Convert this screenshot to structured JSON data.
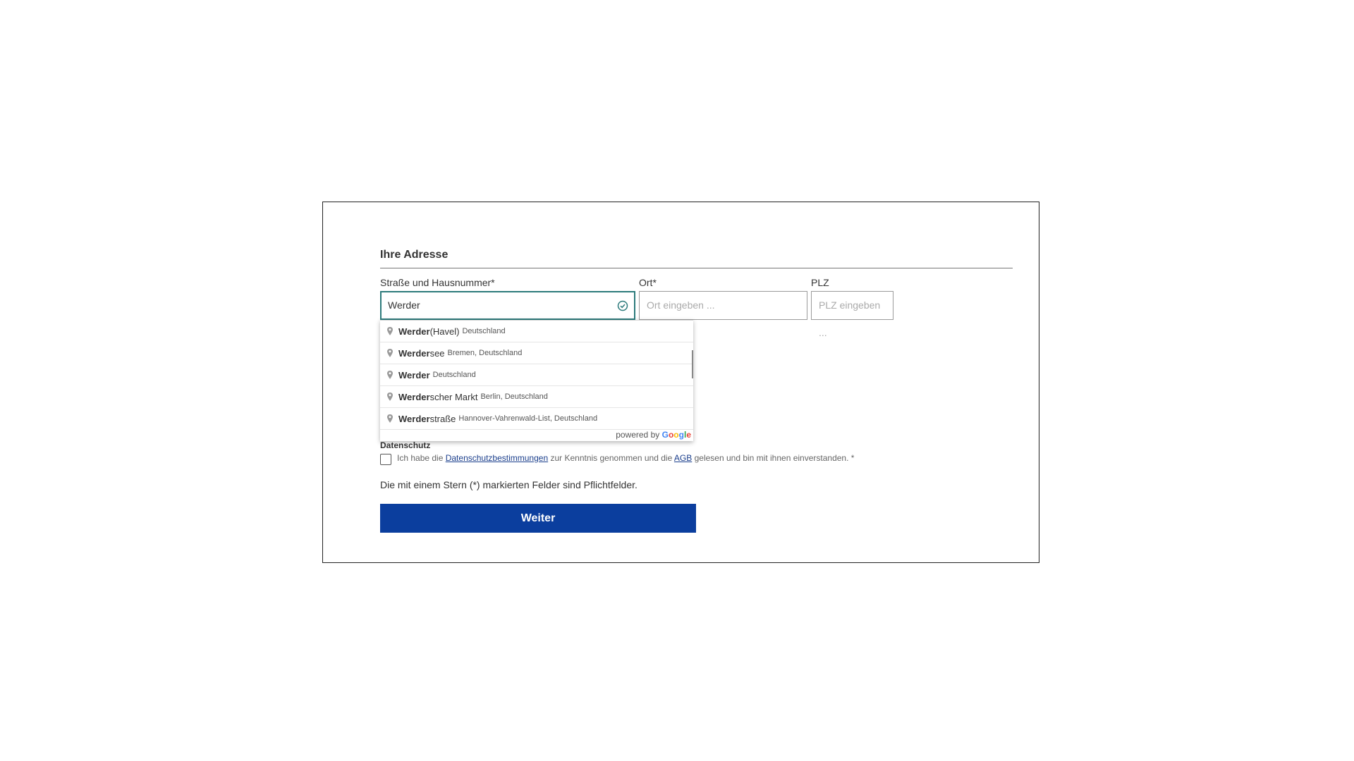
{
  "section_title": "Ihre Adresse",
  "fields": {
    "street": {
      "label": "Straße und Hausnummer*",
      "value": "Werder"
    },
    "city": {
      "label": "Ort*",
      "placeholder": "Ort eingeben ..."
    },
    "zip": {
      "label": "PLZ",
      "placeholder": "PLZ eingeben ..."
    }
  },
  "autocomplete": {
    "items": [
      {
        "match": "Werder",
        "rest": " (Havel)",
        "secondary": "Deutschland"
      },
      {
        "match": "Werder",
        "rest": "see",
        "secondary": "Bremen, Deutschland"
      },
      {
        "match": "Werder",
        "rest": "",
        "secondary": "Deutschland"
      },
      {
        "match": "Werder",
        "rest": "scher Markt",
        "secondary": "Berlin, Deutschland"
      },
      {
        "match": "Werder",
        "rest": "straße",
        "secondary": "Hannover-Vahrenwald-List, Deutschland"
      }
    ],
    "powered_by": "powered by",
    "google": [
      "G",
      "o",
      "o",
      "g",
      "l",
      "e"
    ]
  },
  "privacy": {
    "label": "Datenschutz",
    "text_1": "Ich habe die ",
    "link_1": "Datenschutzbestimmungen",
    "text_2": " zur Kenntnis genommen und die ",
    "link_2": "AGB",
    "text_3": " gelesen und bin mit ihnen einverstanden. *"
  },
  "required_note": "Die mit einem Stern (*) markierten Felder sind Pflichtfelder.",
  "submit_label": "Weiter",
  "colors": {
    "button": "#0b3e9e",
    "focus_border": "#2c7a7b",
    "link": "#1a3e8c"
  }
}
